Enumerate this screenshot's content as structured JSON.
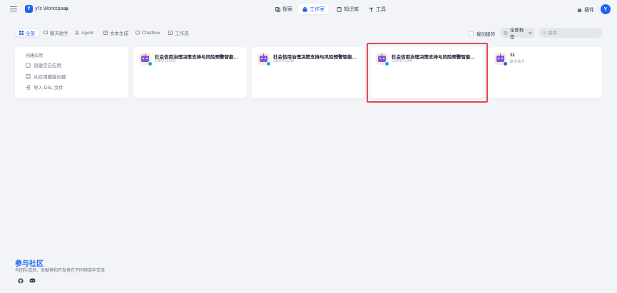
{
  "header": {
    "workspace_initial": "Y",
    "workspace_name": "yl's Workspace",
    "nav": [
      {
        "label": "探索",
        "icon": "explore-icon"
      },
      {
        "label": "工作室",
        "icon": "studio-icon",
        "active": true
      },
      {
        "label": "知识库",
        "icon": "knowledge-icon"
      },
      {
        "label": "工具",
        "icon": "tools-icon"
      }
    ],
    "plugin_label": "插件",
    "user_initial": "Y"
  },
  "filters": {
    "tabs": [
      {
        "label": "全部",
        "icon": "grid-icon",
        "active": true
      },
      {
        "label": "聊天助手",
        "icon": "chat-icon"
      },
      {
        "label": "Agent",
        "icon": "agent-icon"
      },
      {
        "label": "文本生成",
        "icon": "text-icon"
      },
      {
        "label": "Chatflow",
        "icon": "chatflow-icon"
      },
      {
        "label": "工作流",
        "icon": "workflow-icon"
      }
    ],
    "mine_label": "我创建的",
    "tag_label": "全部标签",
    "search_placeholder": "搜索"
  },
  "create_card": {
    "title": "创建应用",
    "items": [
      {
        "label": "创建空白应用",
        "icon": "blank-file-icon"
      },
      {
        "label": "从应用模版创建",
        "icon": "template-icon"
      },
      {
        "label": "导入 DSL 文件",
        "icon": "import-icon"
      }
    ]
  },
  "apps": [
    {
      "name": "社会信用治理决策支持与风险预警智能分...",
      "mode": "CHATFLOW"
    },
    {
      "name": "社会信用治理决策支持与风险预警智能分...",
      "mode": "CHATFLOW"
    },
    {
      "name": "社会信用治理决策支持与风险预警智能分析",
      "mode": "CHATFLOW"
    },
    {
      "name": "11",
      "mode": "聊天助手"
    }
  ],
  "community": {
    "title": "参与社区",
    "subtitle": "与团队成员、贡献者和开发者在不同频道中交流"
  },
  "colors": {
    "accent": "#1c64f2",
    "highlight": "#e5484d",
    "background": "#f2f4f7"
  }
}
